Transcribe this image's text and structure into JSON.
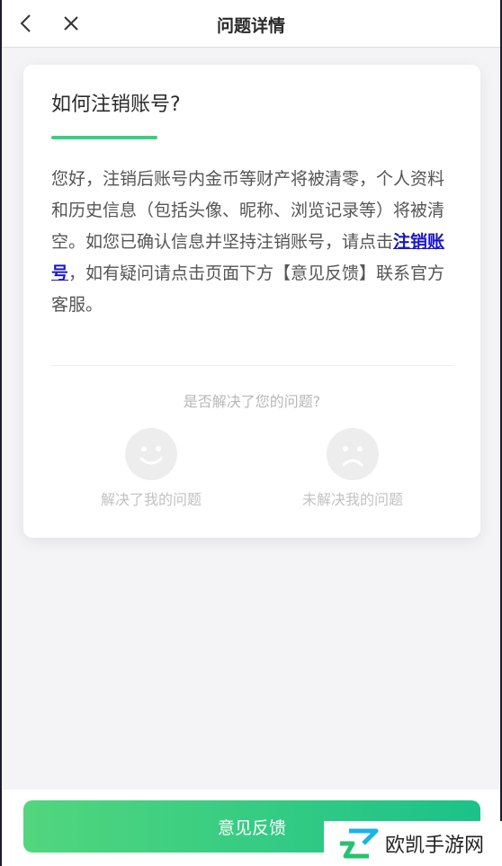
{
  "header": {
    "title": "问题详情"
  },
  "question": {
    "title": "如何注销账号?",
    "answer_before": "您好，注销后账号内金币等财产将被清零，个人资料和历史信息（包括头像、昵称、浏览记录等）将被清空。如您已确认信息并坚持注销账号，请点击",
    "answer_link": "注销账号",
    "answer_after": "，如有疑问请点击页面下方【意见反馈】联系官方客服。"
  },
  "feedback": {
    "prompt": "是否解决了您的问题?",
    "solved_label": "解决了我的问题",
    "unsolved_label": "未解决我的问题"
  },
  "bottom": {
    "feedback_button": "意见反馈"
  },
  "watermark": {
    "text": "欧凯手游网"
  },
  "colors": {
    "accent": "#3ccf82",
    "link": "#1a16c8",
    "button_start": "#52d67d",
    "button_end": "#1bc289"
  }
}
